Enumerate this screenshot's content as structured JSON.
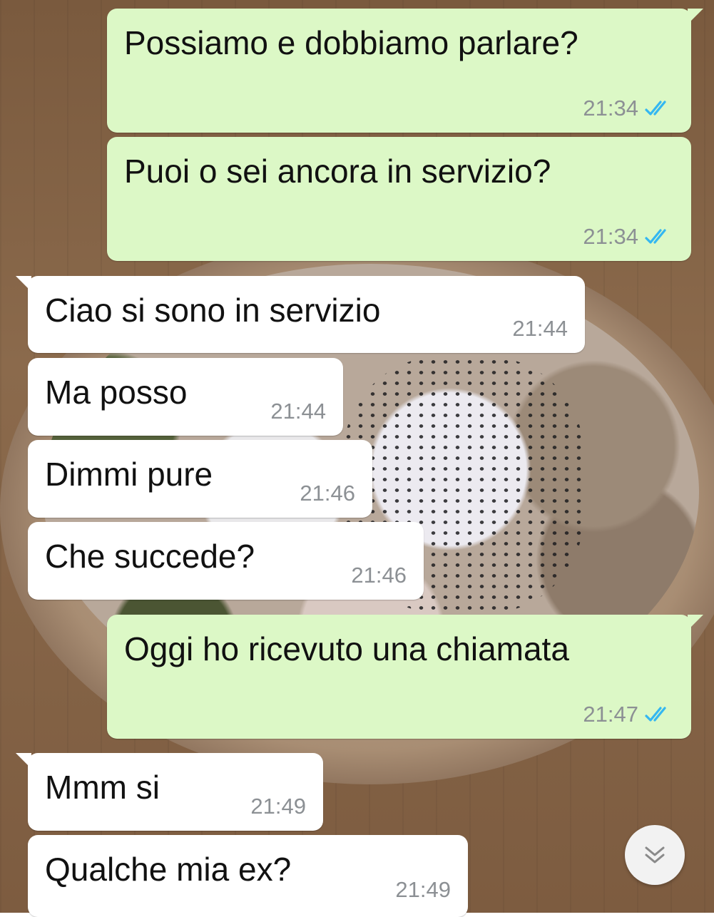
{
  "messages": [
    {
      "text": "Possiamo e dobbiamo parlare?",
      "time": "21:34",
      "dir": "out"
    },
    {
      "text": "Puoi o sei ancora in servizio?",
      "time": "21:34",
      "dir": "out"
    },
    {
      "text": "Ciao si sono in servizio",
      "time": "21:44",
      "dir": "in"
    },
    {
      "text": "Ma posso",
      "time": "21:44",
      "dir": "in"
    },
    {
      "text": "Dimmi pure",
      "time": "21:46",
      "dir": "in"
    },
    {
      "text": "Che succede?",
      "time": "21:46",
      "dir": "in"
    },
    {
      "text": "Oggi ho ricevuto una chiamata",
      "time": "21:47",
      "dir": "out"
    },
    {
      "text": "Mmm si",
      "time": "21:49",
      "dir": "in"
    },
    {
      "text": "Qualche mia ex?",
      "time": "21:49",
      "dir": "in"
    }
  ],
  "colors": {
    "outgoing_bubble": "#dcf8c6",
    "incoming_bubble": "#ffffff",
    "read_ticks": "#34b7f1",
    "timestamp": "#8c9094"
  },
  "icons": {
    "read_status": "double-check-icon",
    "scroll_down": "double-chevron-down-icon"
  }
}
